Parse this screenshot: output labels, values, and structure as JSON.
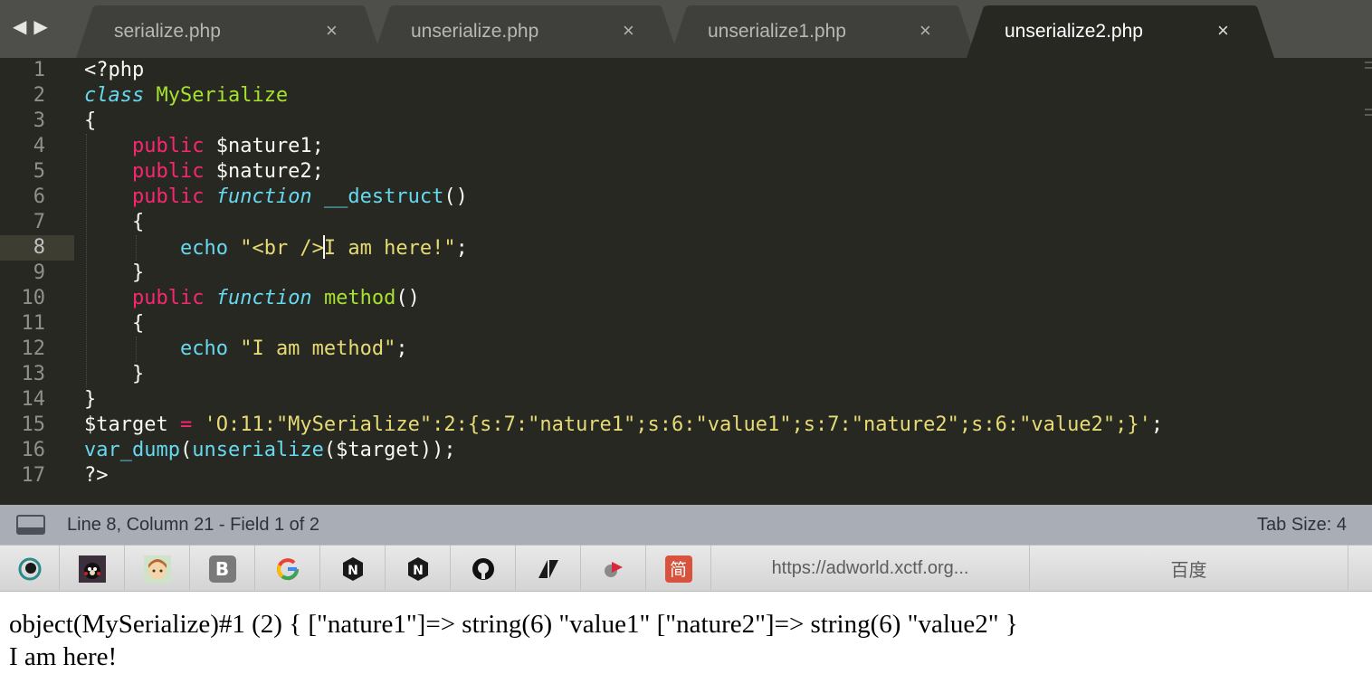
{
  "tabs": [
    {
      "label": "serialize.php",
      "close": "×",
      "active": false
    },
    {
      "label": "unserialize.php",
      "close": "×",
      "active": false
    },
    {
      "label": "unserialize1.php",
      "close": "×",
      "active": false
    },
    {
      "label": "unserialize2.php",
      "close": "×",
      "active": true
    }
  ],
  "nav": {
    "back": "◀",
    "forward": "▶"
  },
  "editor": {
    "lines": [
      {
        "n": "1",
        "tokens": [
          [
            "<?php",
            "plain"
          ]
        ]
      },
      {
        "n": "2",
        "tokens": [
          [
            "class",
            "storage"
          ],
          [
            " ",
            "plain"
          ],
          [
            "MySerialize",
            "entity"
          ]
        ]
      },
      {
        "n": "3",
        "tokens": [
          [
            "{",
            "plain"
          ]
        ]
      },
      {
        "n": "4",
        "tokens": [
          [
            "    ",
            "plain"
          ],
          [
            "public",
            "kw"
          ],
          [
            " $nature1;",
            "plain"
          ]
        ]
      },
      {
        "n": "5",
        "tokens": [
          [
            "    ",
            "plain"
          ],
          [
            "public",
            "kw"
          ],
          [
            " $nature2;",
            "plain"
          ]
        ]
      },
      {
        "n": "6",
        "tokens": [
          [
            "    ",
            "plain"
          ],
          [
            "public",
            "kw"
          ],
          [
            " ",
            "plain"
          ],
          [
            "function",
            "storage"
          ],
          [
            " ",
            "plain"
          ],
          [
            "__destruct",
            "builtin"
          ],
          [
            "()",
            "plain"
          ]
        ]
      },
      {
        "n": "7",
        "tokens": [
          [
            "    {",
            "plain"
          ]
        ]
      },
      {
        "n": "8",
        "tokens": [
          [
            "        ",
            "plain"
          ],
          [
            "echo",
            "builtin"
          ],
          [
            " ",
            "plain"
          ],
          [
            "\"<br />",
            "string"
          ],
          [
            "|caret|",
            "caret"
          ],
          [
            "I am here!\"",
            "string"
          ],
          [
            ";",
            "plain"
          ]
        ]
      },
      {
        "n": "9",
        "tokens": [
          [
            "    }",
            "plain"
          ]
        ]
      },
      {
        "n": "10",
        "tokens": [
          [
            "    ",
            "plain"
          ],
          [
            "public",
            "kw"
          ],
          [
            " ",
            "plain"
          ],
          [
            "function",
            "storage"
          ],
          [
            " ",
            "plain"
          ],
          [
            "method",
            "entity"
          ],
          [
            "()",
            "plain"
          ]
        ]
      },
      {
        "n": "11",
        "tokens": [
          [
            "    {",
            "plain"
          ]
        ]
      },
      {
        "n": "12",
        "tokens": [
          [
            "        ",
            "plain"
          ],
          [
            "echo",
            "builtin"
          ],
          [
            " ",
            "plain"
          ],
          [
            "\"I am method\"",
            "string"
          ],
          [
            ";",
            "plain"
          ]
        ]
      },
      {
        "n": "13",
        "tokens": [
          [
            "    }",
            "plain"
          ]
        ]
      },
      {
        "n": "14",
        "tokens": [
          [
            "}",
            "plain"
          ]
        ]
      },
      {
        "n": "15",
        "tokens": [
          [
            "$target ",
            "plain"
          ],
          [
            "=",
            "kw"
          ],
          [
            " ",
            "plain"
          ],
          [
            "'O:11:\"MySerialize\":2:{s:7:\"nature1\";s:6:\"value1\";s:7:\"nature2\";s:6:\"value2\";}'",
            "string"
          ],
          [
            ";",
            "plain"
          ]
        ]
      },
      {
        "n": "16",
        "tokens": [
          [
            "var_dump",
            "builtin"
          ],
          [
            "(",
            "plain"
          ],
          [
            "unserialize",
            "builtin"
          ],
          [
            "($target));",
            "plain"
          ]
        ]
      },
      {
        "n": "17",
        "tokens": [
          [
            "?>",
            "plain"
          ]
        ]
      }
    ],
    "current_line": "8"
  },
  "status": {
    "position": "Line 8, Column 21 - Field 1 of 2",
    "tab_size": "Tab Size: 4"
  },
  "bookmarks": [
    {
      "icon": "eye-spiral-icon",
      "glyph": "◉",
      "color": "#2b8a8a"
    },
    {
      "icon": "kumamon-avatar-icon",
      "glyph": "●",
      "color": "#222222"
    },
    {
      "icon": "cartoon-face-icon",
      "glyph": "☻",
      "color": "#c98a3a"
    },
    {
      "icon": "bootstrap-b-icon",
      "glyph": "B",
      "color": "#7a7a7a"
    },
    {
      "icon": "google-g-icon",
      "glyph": "G",
      "color": "#4285f4"
    },
    {
      "icon": "n-badge-icon",
      "glyph": "N",
      "color": "#1a1a1a"
    },
    {
      "icon": "n-badge-icon-2",
      "glyph": "N",
      "color": "#1a1a1a"
    },
    {
      "icon": "github-icon",
      "glyph": "●",
      "color": "#111111"
    },
    {
      "icon": "zendesk-icon",
      "glyph": "◩",
      "color": "#1a1a1a"
    },
    {
      "icon": "video-play-icon",
      "glyph": "▶",
      "color": "#d9283c"
    },
    {
      "icon": "jian-icon",
      "glyph": "简",
      "color": "#ffffff"
    }
  ],
  "bookmark_links": [
    {
      "label": "https://adworld.xctf.org..."
    },
    {
      "label": "百度"
    }
  ],
  "output": {
    "line1": "object(MySerialize)#1 (2) { [\"nature1\"]=> string(6) \"value1\" [\"nature2\"]=> string(6) \"value2\" }",
    "line2": "I am here!"
  },
  "colors": {
    "editor_bg": "#272822",
    "keyword": "#f92672",
    "storage": "#66d9ef",
    "entity": "#a6e22e",
    "string": "#e6db74",
    "statusbar": "#a9adb5"
  }
}
